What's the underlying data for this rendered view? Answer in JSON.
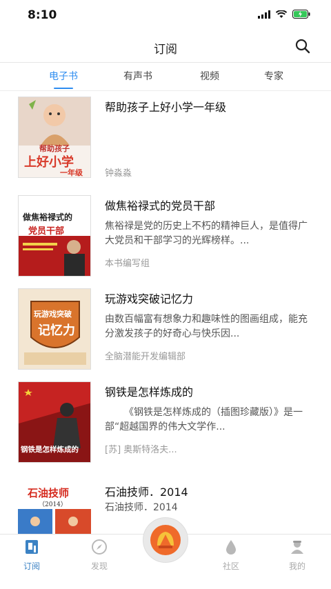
{
  "status": {
    "time": "8:10"
  },
  "navbar": {
    "title": "订阅"
  },
  "tabs": [
    {
      "label": "电子书",
      "active": true
    },
    {
      "label": "有声书",
      "active": false
    },
    {
      "label": "视频",
      "active": false
    },
    {
      "label": "专家",
      "active": false
    }
  ],
  "books": [
    {
      "title": "帮助孩子上好小学一年级",
      "desc": "",
      "author": "钟淼淼",
      "cover": {
        "text1": "帮助孩子",
        "text2": "上好小学",
        "text3": "一年级",
        "bg": "#f7f1ec",
        "accent": "#d83a2a"
      }
    },
    {
      "title": "做焦裕禄式的党员干部",
      "desc": "焦裕禄是党的历史上不朽的精神巨人，是值得广大党员和干部学习的光辉榜样。...",
      "author": "本书编写组",
      "cover": {
        "text1": "做焦裕禄式的",
        "text2": "党员干部",
        "bg": "#ffffff",
        "accent": "#c8231f"
      }
    },
    {
      "title": "玩游戏突破记忆力",
      "desc": "由数百幅富有想象力和趣味性的图画组成，能充分激发孩子的好奇心与快乐因...",
      "author": "全脑潜能开发编辑部",
      "cover": {
        "text1": "玩游戏突破",
        "text2": "记忆力",
        "bg": "#f3e6d2",
        "accent": "#d9742c"
      }
    },
    {
      "title": "钢铁是怎样炼成的",
      "desc": "《钢铁是怎样炼成的（插图珍藏版）》是一部“超越国界的伟大文学作...",
      "author": "[苏] 奥斯特洛夫...",
      "cover": {
        "text1": "钢铁是怎样炼成的",
        "bg": "#c62322",
        "accent": "#f5d23a"
      }
    },
    {
      "title": "石油技师．2014",
      "desc": "石油技师．2014",
      "author": "",
      "cover": {
        "text1": "石油技师",
        "text2": "（2014）",
        "bg": "#ffffff",
        "accent": "#d52a1e"
      }
    }
  ],
  "tabbar": [
    {
      "label": "订阅",
      "icon": "book-reader-icon",
      "active": true
    },
    {
      "label": "发现",
      "icon": "compass-icon",
      "active": false
    },
    {
      "label": "",
      "icon": "shell-logo-icon",
      "active": false
    },
    {
      "label": "社区",
      "icon": "drop-icon",
      "active": false
    },
    {
      "label": "我的",
      "icon": "person-icon",
      "active": false
    }
  ],
  "colors": {
    "accent": "#2d8cf0",
    "tabActive": "#3b82c4",
    "inactive": "#aaaaaa"
  }
}
